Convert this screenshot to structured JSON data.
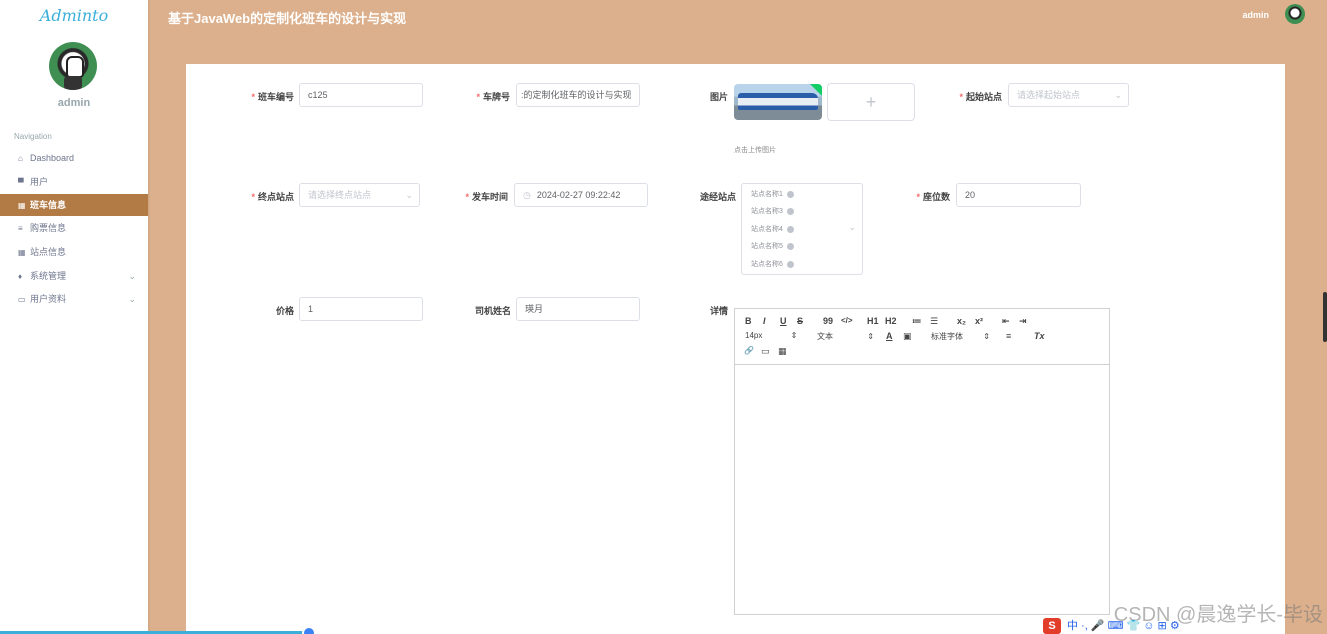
{
  "app": {
    "logo": "Adminto",
    "title": "基于JavaWeb的定制化班车的设计与实现"
  },
  "user": {
    "name": "admin"
  },
  "sidebar": {
    "heading": "Navigation",
    "items": [
      {
        "label": "Dashboard",
        "icon": "home-icon"
      },
      {
        "label": "用户",
        "icon": "user-icon"
      },
      {
        "label": "班车信息",
        "icon": "grid-icon",
        "active": true
      },
      {
        "label": "购票信息",
        "icon": "list-icon"
      },
      {
        "label": "站点信息",
        "icon": "grid-icon"
      },
      {
        "label": "系统管理",
        "icon": "gear-icon"
      },
      {
        "label": "用户资料",
        "icon": "doc-icon"
      }
    ]
  },
  "form": {
    "bus_no": {
      "label": "班车编号",
      "value": "c125"
    },
    "plate": {
      "label": "车牌号",
      "value": ":的定制化班车的设计与实现"
    },
    "image": {
      "label": "图片",
      "tip": "点击上传图片",
      "add": "+"
    },
    "start_station": {
      "label": "起始站点",
      "placeholder": "请选择起始站点"
    },
    "end_station": {
      "label": "终点站点",
      "placeholder": "请选择终点站点"
    },
    "depart_time": {
      "label": "发车时间",
      "value": "2024-02-27 09:22:42"
    },
    "via": {
      "label": "途经站点",
      "tags": [
        "站点名称1",
        "站点名称3",
        "站点名称4",
        "站点名称5",
        "站点名称6"
      ]
    },
    "seats": {
      "label": "座位数",
      "value": "20"
    },
    "price": {
      "label": "价格",
      "value": "1"
    },
    "driver": {
      "label": "司机姓名",
      "value": "瑛月"
    },
    "detail": {
      "label": "详情",
      "size": "14px",
      "block": "文本",
      "font": "标准字体",
      "buttons": [
        "B",
        "I",
        "U",
        "S",
        "99",
        "</>",
        "H1",
        "H2",
        "≔",
        "☰",
        "x₂",
        "x²",
        "⇤",
        "⇥",
        "A",
        "▣",
        "≡",
        "Tx",
        "🔗",
        "▭",
        "▦"
      ]
    }
  },
  "watermark": "CSDN @晨逸学长-毕设",
  "ime": {
    "s": "S",
    "text": "中 ·, 🎤 ⌨ 👕 ☺ ⊞ ⚙"
  }
}
